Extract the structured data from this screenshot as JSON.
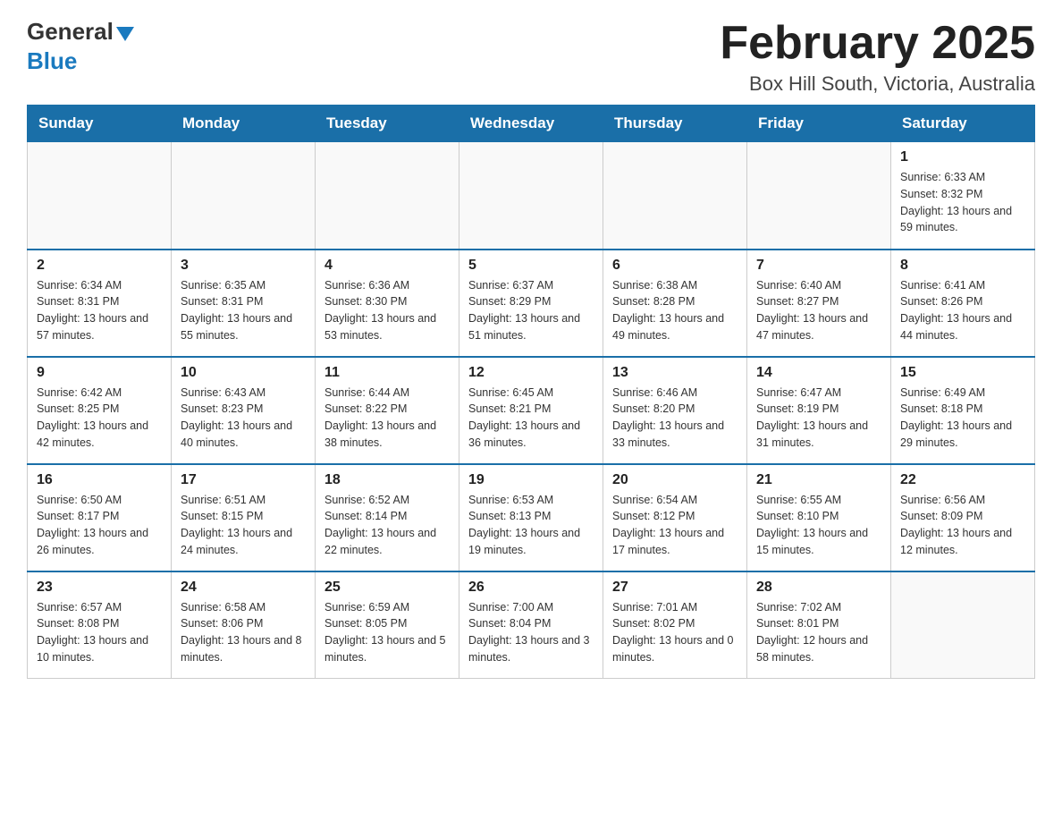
{
  "header": {
    "logo_general": "General",
    "logo_blue": "Blue",
    "title": "February 2025",
    "subtitle": "Box Hill South, Victoria, Australia"
  },
  "days_of_week": [
    "Sunday",
    "Monday",
    "Tuesday",
    "Wednesday",
    "Thursday",
    "Friday",
    "Saturday"
  ],
  "weeks": [
    [
      {
        "day": "",
        "info": ""
      },
      {
        "day": "",
        "info": ""
      },
      {
        "day": "",
        "info": ""
      },
      {
        "day": "",
        "info": ""
      },
      {
        "day": "",
        "info": ""
      },
      {
        "day": "",
        "info": ""
      },
      {
        "day": "1",
        "info": "Sunrise: 6:33 AM\nSunset: 8:32 PM\nDaylight: 13 hours and 59 minutes."
      }
    ],
    [
      {
        "day": "2",
        "info": "Sunrise: 6:34 AM\nSunset: 8:31 PM\nDaylight: 13 hours and 57 minutes."
      },
      {
        "day": "3",
        "info": "Sunrise: 6:35 AM\nSunset: 8:31 PM\nDaylight: 13 hours and 55 minutes."
      },
      {
        "day": "4",
        "info": "Sunrise: 6:36 AM\nSunset: 8:30 PM\nDaylight: 13 hours and 53 minutes."
      },
      {
        "day": "5",
        "info": "Sunrise: 6:37 AM\nSunset: 8:29 PM\nDaylight: 13 hours and 51 minutes."
      },
      {
        "day": "6",
        "info": "Sunrise: 6:38 AM\nSunset: 8:28 PM\nDaylight: 13 hours and 49 minutes."
      },
      {
        "day": "7",
        "info": "Sunrise: 6:40 AM\nSunset: 8:27 PM\nDaylight: 13 hours and 47 minutes."
      },
      {
        "day": "8",
        "info": "Sunrise: 6:41 AM\nSunset: 8:26 PM\nDaylight: 13 hours and 44 minutes."
      }
    ],
    [
      {
        "day": "9",
        "info": "Sunrise: 6:42 AM\nSunset: 8:25 PM\nDaylight: 13 hours and 42 minutes."
      },
      {
        "day": "10",
        "info": "Sunrise: 6:43 AM\nSunset: 8:23 PM\nDaylight: 13 hours and 40 minutes."
      },
      {
        "day": "11",
        "info": "Sunrise: 6:44 AM\nSunset: 8:22 PM\nDaylight: 13 hours and 38 minutes."
      },
      {
        "day": "12",
        "info": "Sunrise: 6:45 AM\nSunset: 8:21 PM\nDaylight: 13 hours and 36 minutes."
      },
      {
        "day": "13",
        "info": "Sunrise: 6:46 AM\nSunset: 8:20 PM\nDaylight: 13 hours and 33 minutes."
      },
      {
        "day": "14",
        "info": "Sunrise: 6:47 AM\nSunset: 8:19 PM\nDaylight: 13 hours and 31 minutes."
      },
      {
        "day": "15",
        "info": "Sunrise: 6:49 AM\nSunset: 8:18 PM\nDaylight: 13 hours and 29 minutes."
      }
    ],
    [
      {
        "day": "16",
        "info": "Sunrise: 6:50 AM\nSunset: 8:17 PM\nDaylight: 13 hours and 26 minutes."
      },
      {
        "day": "17",
        "info": "Sunrise: 6:51 AM\nSunset: 8:15 PM\nDaylight: 13 hours and 24 minutes."
      },
      {
        "day": "18",
        "info": "Sunrise: 6:52 AM\nSunset: 8:14 PM\nDaylight: 13 hours and 22 minutes."
      },
      {
        "day": "19",
        "info": "Sunrise: 6:53 AM\nSunset: 8:13 PM\nDaylight: 13 hours and 19 minutes."
      },
      {
        "day": "20",
        "info": "Sunrise: 6:54 AM\nSunset: 8:12 PM\nDaylight: 13 hours and 17 minutes."
      },
      {
        "day": "21",
        "info": "Sunrise: 6:55 AM\nSunset: 8:10 PM\nDaylight: 13 hours and 15 minutes."
      },
      {
        "day": "22",
        "info": "Sunrise: 6:56 AM\nSunset: 8:09 PM\nDaylight: 13 hours and 12 minutes."
      }
    ],
    [
      {
        "day": "23",
        "info": "Sunrise: 6:57 AM\nSunset: 8:08 PM\nDaylight: 13 hours and 10 minutes."
      },
      {
        "day": "24",
        "info": "Sunrise: 6:58 AM\nSunset: 8:06 PM\nDaylight: 13 hours and 8 minutes."
      },
      {
        "day": "25",
        "info": "Sunrise: 6:59 AM\nSunset: 8:05 PM\nDaylight: 13 hours and 5 minutes."
      },
      {
        "day": "26",
        "info": "Sunrise: 7:00 AM\nSunset: 8:04 PM\nDaylight: 13 hours and 3 minutes."
      },
      {
        "day": "27",
        "info": "Sunrise: 7:01 AM\nSunset: 8:02 PM\nDaylight: 13 hours and 0 minutes."
      },
      {
        "day": "28",
        "info": "Sunrise: 7:02 AM\nSunset: 8:01 PM\nDaylight: 12 hours and 58 minutes."
      },
      {
        "day": "",
        "info": ""
      }
    ]
  ]
}
